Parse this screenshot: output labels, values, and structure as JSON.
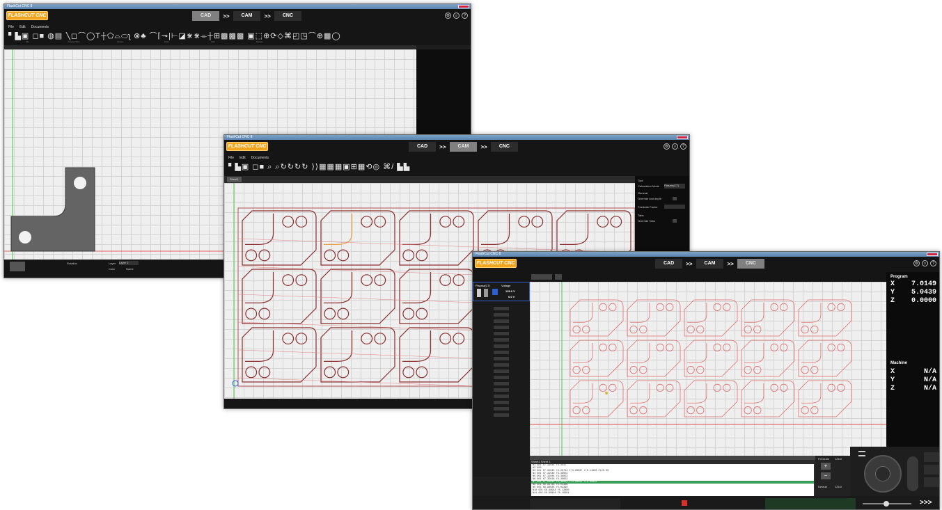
{
  "app": {
    "logo": "FLASHCUT CNC",
    "window_title": "FlashCut CNC 8",
    "modes": [
      "CAD",
      "CAM",
      "CNC"
    ],
    "arrow": ">>",
    "top_icons": [
      "settings-icon",
      "zoom-icon",
      "help-icon"
    ],
    "help_glyph": "?"
  },
  "cad": {
    "menu": [
      "File",
      "Edit",
      "Documents"
    ],
    "group_labels": [
      "File",
      "Display Tabs",
      "Modes",
      "Draw",
      "Edit",
      "Shapes"
    ],
    "layer_label": "Layer",
    "layer_value": "Layer 0",
    "color_label": "Color",
    "name_label": "Name",
    "rotation_label": "Rotation"
  },
  "cam": {
    "menu": [
      "File",
      "Edit",
      "Documents"
    ],
    "tab_label": "Sheet1",
    "panel": {
      "tool_header": "Tool",
      "tool_label": "Calculation Mode",
      "tool_value": "Plasma(CT)",
      "general_header": "General",
      "override_label": "Override tool depth",
      "feedrate_label": "Feedrate Factor",
      "tabs_header": "Tabs",
      "override_tabs_label": "Override Tabs"
    }
  },
  "cnc": {
    "panel_header_left": "Plasma(CT)",
    "panel_header_right": "Voltage",
    "voltage_value": "135.0 V",
    "voltage_set": "0.0 V",
    "program_label": "Program",
    "machine_label": "Machine",
    "program_axes": [
      {
        "axis": "X",
        "value": "7.0149"
      },
      {
        "axis": "Y",
        "value": "5.0439"
      },
      {
        "axis": "Z",
        "value": "0.0000"
      }
    ],
    "machine_axes": [
      {
        "axis": "X",
        "value": "N/A"
      },
      {
        "axis": "Y",
        "value": "N/A"
      },
      {
        "axis": "Z",
        "value": "N/A"
      }
    ],
    "gcode_title": "Sheet1 Sheet 1",
    "feedrate_label": "Feedrate",
    "feedrate_value": "125.0",
    "default_label": "Default",
    "default_value": "125.0",
    "bottom_arrows": ">>>",
    "gcode_lines": [
      "N1 G01 X7.31544 Y4.1547",
      "N2 G00",
      "N3 G01 X7.31545 Y4.26741 I+3.00897 J+5.11808 F125.00",
      "N4 G01 X7.31546 Y4.36653",
      "N5 G01 X7.32048 Y4.36653",
      "N6 G01 X7.35548 Y4.36653",
      "N7 G01 X7.31545 Y4.36653 I+3.00001 J+5.00003",
      "N8 G01 X6.99748 Y5.04389",
      "N9 G01 X6.98948 Y5.04390",
      "N10 G01 X6.98948 Y5.13880",
      "N11 G01 X6.98948 Y5.19994"
    ]
  },
  "colors": {
    "accent_orange": "#f2a51c",
    "part_red": "#8a2d2d",
    "cnc_path": "#e46a6a",
    "progress_green": "#3a9d55"
  }
}
